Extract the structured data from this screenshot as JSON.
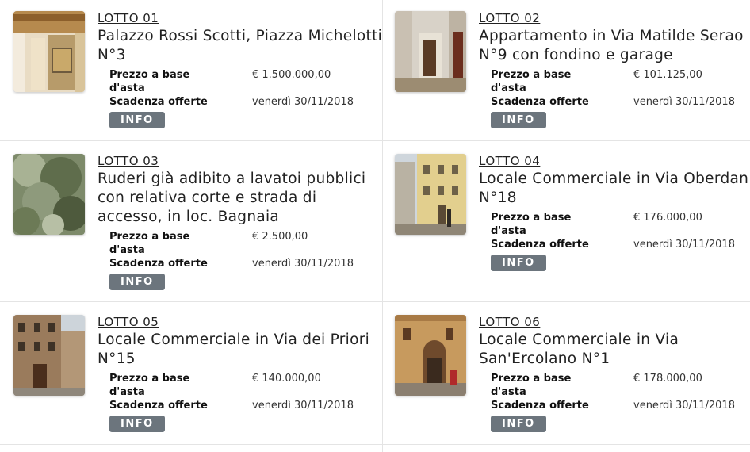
{
  "labels": {
    "price_label": "Prezzo a base",
    "price_label_line2": "d'asta",
    "deadline_label": "Scadenza offerte",
    "info_button": "INFO"
  },
  "lots": [
    {
      "lot": "LOTTO 01",
      "title": "Palazzo Rossi Scotti, Piazza Michelotti N°3",
      "price": "€ 1.500.000,00",
      "deadline": "venerdì 30/11/2018",
      "image": "fresco-interior"
    },
    {
      "lot": "LOTTO 02",
      "title": "Appartamento in Via Matilde Serao N°9 con fondino e garage",
      "price": "€ 101.125,00",
      "deadline": "venerdì 30/11/2018",
      "image": "corridor"
    },
    {
      "lot": "LOTTO 03",
      "title": "Ruderi già adibito a lavatoi pubblici con relativa corte e strada di accesso, in loc. Bagnaia",
      "price": "€ 2.500,00",
      "deadline": "venerdì 30/11/2018",
      "image": "overgrown-ruins"
    },
    {
      "lot": "LOTTO 04",
      "title": "Locale Commerciale in Via Oberdan N°18",
      "price": "€ 176.000,00",
      "deadline": "venerdì 30/11/2018",
      "image": "street-yellow-building"
    },
    {
      "lot": "LOTTO 05",
      "title": "Locale Commerciale in Via dei Priori N°15",
      "price": "€ 140.000,00",
      "deadline": "venerdì 30/11/2018",
      "image": "stone-street"
    },
    {
      "lot": "LOTTO 06",
      "title": "Locale Commerciale in Via San'Ercolano N°1",
      "price": "€ 178.000,00",
      "deadline": "venerdì 30/11/2018",
      "image": "shopfront"
    }
  ]
}
